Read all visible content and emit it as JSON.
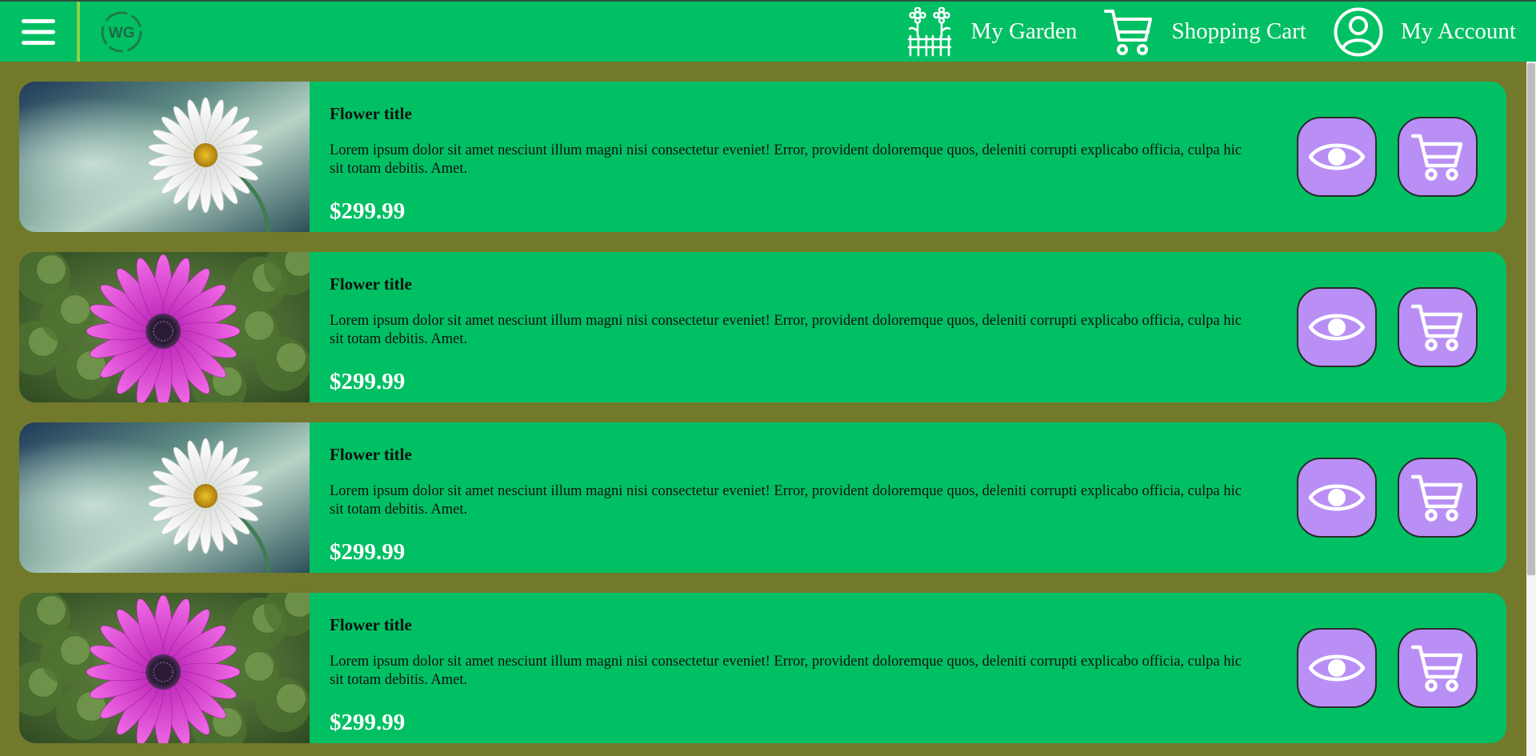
{
  "header": {
    "logo_text": "WG",
    "nav": [
      {
        "icon": "garden-icon",
        "label": "My Garden"
      },
      {
        "icon": "cart-icon",
        "label": "Shopping Cart"
      },
      {
        "icon": "user-icon",
        "label": "My Account"
      }
    ]
  },
  "colors": {
    "accent_green": "#00c063",
    "background_olive": "#72792b",
    "button_purple": "#b98ff5",
    "divider_green": "#8ed24a"
  },
  "products": [
    {
      "image": "white-daisy",
      "title": "Flower title",
      "description": "Lorem ipsum dolor sit amet nesciunt illum magni nisi consectetur eveniet! Error, provident doloremque quos, deleniti corrupti explicabo officia, culpa hic sit totam debitis. Amet.",
      "price": "$299.99"
    },
    {
      "image": "pink-daisy",
      "title": "Flower title",
      "description": "Lorem ipsum dolor sit amet nesciunt illum magni nisi consectetur eveniet! Error, provident doloremque quos, deleniti corrupti explicabo officia, culpa hic sit totam debitis. Amet.",
      "price": "$299.99"
    },
    {
      "image": "white-daisy",
      "title": "Flower title",
      "description": "Lorem ipsum dolor sit amet nesciunt illum magni nisi consectetur eveniet! Error, provident doloremque quos, deleniti corrupti explicabo officia, culpa hic sit totam debitis. Amet.",
      "price": "$299.99"
    },
    {
      "image": "pink-daisy",
      "title": "Flower title",
      "description": "Lorem ipsum dolor sit amet nesciunt illum magni nisi consectetur eveniet! Error, provident doloremque quos, deleniti corrupti explicabo officia, culpa hic sit totam debitis. Amet.",
      "price": "$299.99"
    }
  ]
}
